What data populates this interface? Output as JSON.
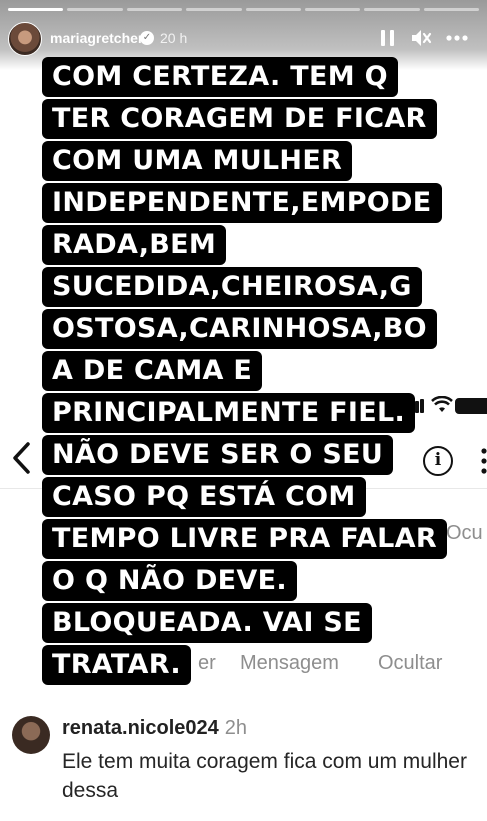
{
  "story": {
    "username": "mariagretchen",
    "time": "20 h",
    "progress_total": 8,
    "progress_done": 1
  },
  "icons": {
    "pause": "pause-icon",
    "mute": "speaker-muted-icon",
    "more": "more-horizontal-icon",
    "verified": "verified-badge-icon",
    "back": "chevron-left-icon",
    "info": "info-icon"
  },
  "overlay": {
    "lines": [
      "COM CERTEZA. TEM Q",
      "TER CORAGEM DE FICAR",
      "COM UMA MULHER",
      "INDEPENDENTE,EMPODE",
      "RADA,BEM",
      "SUCEDIDA,CHEIROSA,G",
      "OSTOSA,CARINHOSA,BO",
      "A DE CAMA E",
      "PRINCIPALMENTE FIEL.",
      "NÃO DEVE SER O SEU",
      "CASO PQ  ESTÁ COM",
      "TEMPO LIVRE PRA FALAR",
      "O Q NÃO DEVE.",
      "BLOQUEADA. VAI SE",
      "TRATAR."
    ]
  },
  "background": {
    "partial_hide_label": "Ocu",
    "actions": {
      "partial": "er",
      "message": "Mensagem",
      "hide": "Ocultar"
    },
    "comment": {
      "username": "renata.nicole024",
      "time": "2h",
      "text": "Ele tem muita coragem fica com um mulher dessa"
    }
  },
  "colors": {
    "overlay_bg": "#000000",
    "overlay_text": "#ffffff",
    "muted_text": "#8e8e8e"
  }
}
